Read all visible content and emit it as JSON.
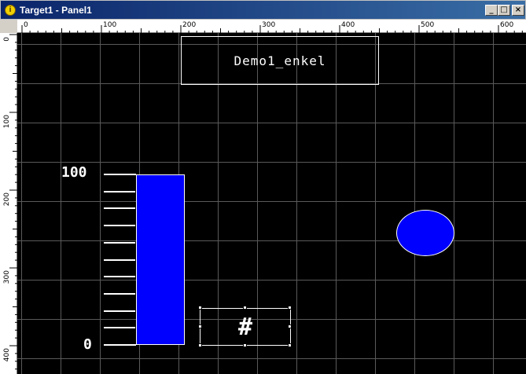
{
  "window": {
    "title": "Target1 - Panel1",
    "app_icon": "app-icon",
    "app_icon_glyph": "i",
    "minimize_glyph": "_",
    "maximize_glyph": "□",
    "close_glyph": "×"
  },
  "rulers": {
    "top_labels": [
      "0",
      "100",
      "200",
      "300",
      "400",
      "500",
      "600"
    ],
    "left_labels": [
      "0",
      "100",
      "200",
      "300",
      "400"
    ]
  },
  "panel": {
    "title_text": "Demo1_enkel",
    "bar_scale": {
      "max_label": "100",
      "min_label": "0",
      "max": 100,
      "min": 0,
      "value": 100
    },
    "value_display": "#",
    "bar_color": "#0000ff",
    "circle_color": "#0000ff"
  }
}
